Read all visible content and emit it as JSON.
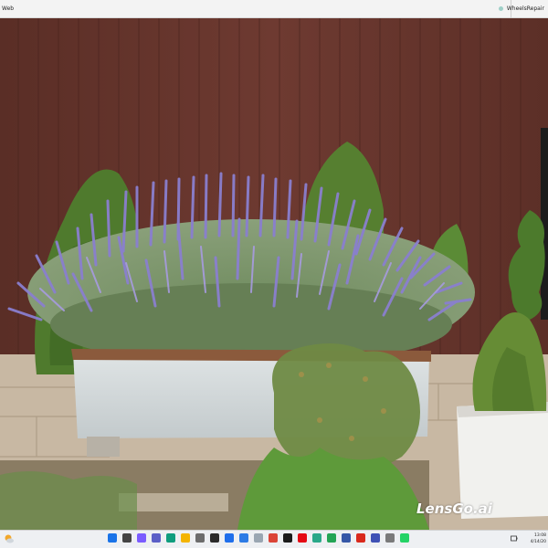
{
  "window": {
    "title": "Web",
    "right_label": "WheelsRepair"
  },
  "watermark": "LensGo.ai",
  "taskbar": {
    "icons": [
      {
        "name": "start-icon",
        "color": "#1a73e8"
      },
      {
        "name": "search-icon",
        "color": "#444444"
      },
      {
        "name": "copilot-icon",
        "color": "#7b5cff"
      },
      {
        "name": "meet-icon",
        "color": "#5b5fc7"
      },
      {
        "name": "edge-icon",
        "color": "#0f9d7e"
      },
      {
        "name": "file-explorer-icon",
        "color": "#f4b400"
      },
      {
        "name": "settings-icon",
        "color": "#6c6c6c"
      },
      {
        "name": "terminal-icon",
        "color": "#2b2b2b"
      },
      {
        "name": "store-icon",
        "color": "#1f6feb"
      },
      {
        "name": "app-icon-blue",
        "color": "#2d7be5"
      },
      {
        "name": "app-icon-light",
        "color": "#9aa6b2"
      },
      {
        "name": "chrome-icon",
        "color": "#db4437"
      },
      {
        "name": "app-icon-black",
        "color": "#1b1b1b"
      },
      {
        "name": "netflix-icon",
        "color": "#e50914"
      },
      {
        "name": "app-icon-teal",
        "color": "#2aa889"
      },
      {
        "name": "app-icon-green",
        "color": "#23a455"
      },
      {
        "name": "app-icon-navy",
        "color": "#3657a7"
      },
      {
        "name": "acrobat-icon",
        "color": "#d9291c"
      },
      {
        "name": "app-icon-indigo",
        "color": "#3f51b5"
      },
      {
        "name": "app-icon-gray",
        "color": "#7a7a7a"
      },
      {
        "name": "whatsapp-icon",
        "color": "#25d366"
      }
    ],
    "time": "13:08",
    "date": "4/14/20"
  }
}
